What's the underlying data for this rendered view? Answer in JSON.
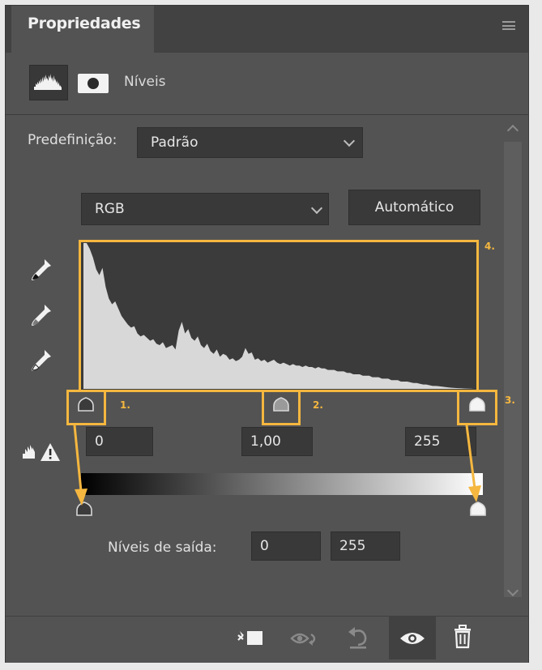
{
  "panel": {
    "tab_title": "Propriedades",
    "adjustment_name": "Níveis"
  },
  "preset": {
    "label": "Predefinição:",
    "value": "Padrão"
  },
  "channel": {
    "value": "RGB"
  },
  "auto_button": "Automático",
  "input_levels": {
    "black": "0",
    "gamma": "1,00",
    "white": "255"
  },
  "output_levels": {
    "label": "Níveis de saída:",
    "black": "0",
    "white": "255"
  },
  "annotations": {
    "a1": "1.",
    "a2": "2.",
    "a3": "3.",
    "a4": "4.",
    "color": "#f5b73f"
  },
  "histogram": {
    "color": "#d8d8d8",
    "values": [
      1.0,
      1.0,
      0.96,
      0.9,
      0.82,
      0.78,
      0.83,
      0.7,
      0.62,
      0.58,
      0.6,
      0.55,
      0.5,
      0.47,
      0.44,
      0.42,
      0.43,
      0.38,
      0.36,
      0.37,
      0.35,
      0.33,
      0.34,
      0.31,
      0.3,
      0.32,
      0.28,
      0.29,
      0.3,
      0.27,
      0.4,
      0.46,
      0.38,
      0.41,
      0.35,
      0.33,
      0.36,
      0.3,
      0.28,
      0.31,
      0.26,
      0.24,
      0.27,
      0.22,
      0.24,
      0.23,
      0.2,
      0.21,
      0.19,
      0.2,
      0.22,
      0.28,
      0.24,
      0.25,
      0.2,
      0.21,
      0.19,
      0.2,
      0.18,
      0.19,
      0.2,
      0.18,
      0.17,
      0.18,
      0.17,
      0.16,
      0.17,
      0.16,
      0.16,
      0.15,
      0.16,
      0.15,
      0.15,
      0.14,
      0.15,
      0.14,
      0.14,
      0.13,
      0.13,
      0.13,
      0.12,
      0.12,
      0.12,
      0.11,
      0.11,
      0.1,
      0.1,
      0.1,
      0.09,
      0.09,
      0.09,
      0.08,
      0.08,
      0.08,
      0.07,
      0.07,
      0.07,
      0.06,
      0.06,
      0.06,
      0.05,
      0.05,
      0.05,
      0.045,
      0.04,
      0.04,
      0.035,
      0.03,
      0.03,
      0.025,
      0.02,
      0.02,
      0.018,
      0.015,
      0.012,
      0.01,
      0.008,
      0.006,
      0.005,
      0.004,
      0.003,
      0.002,
      0.001,
      0.0
    ]
  },
  "icons": {
    "histogram": "histogram-icon",
    "mask": "mask-icon",
    "eyedropper_black": "eyedropper-black-icon",
    "eyedropper_gray": "eyedropper-gray-icon",
    "eyedropper_white": "eyedropper-white-icon",
    "auto_levels": "auto-levels-warning-icon",
    "clip": "clip-to-layer-icon",
    "view_previous": "view-previous-state-icon",
    "reset": "reset-icon",
    "visibility": "eye-icon",
    "delete": "trash-icon",
    "menu": "panel-menu-icon"
  }
}
